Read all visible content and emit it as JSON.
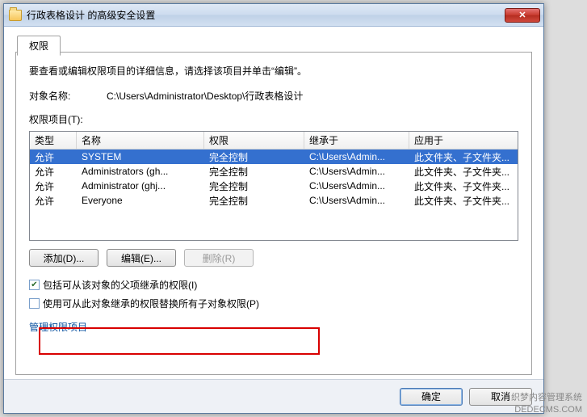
{
  "window": {
    "title": "行政表格设计 的高级安全设置",
    "close_symbol": "✕"
  },
  "tab": {
    "label": "权限"
  },
  "body": {
    "desc": "要查看或编辑权限项目的详细信息，请选择该项目并单击“编辑”。",
    "object_label": "对象名称:",
    "object_value": "C:\\Users\\Administrator\\Desktop\\行政表格设计",
    "perm_items_label": "权限项目(T):"
  },
  "columns": {
    "type": "类型",
    "name": "名称",
    "perm": "权限",
    "inherit": "继承于",
    "apply": "应用于"
  },
  "rows": [
    {
      "type": "允许",
      "name": "SYSTEM",
      "perm": "完全控制",
      "inherit": "C:\\Users\\Admin...",
      "apply": "此文件夹、子文件夹...",
      "selected": true
    },
    {
      "type": "允许",
      "name": "Administrators (gh...",
      "perm": "完全控制",
      "inherit": "C:\\Users\\Admin...",
      "apply": "此文件夹、子文件夹...",
      "selected": false
    },
    {
      "type": "允许",
      "name": "Administrator (ghj...",
      "perm": "完全控制",
      "inherit": "C:\\Users\\Admin...",
      "apply": "此文件夹、子文件夹...",
      "selected": false
    },
    {
      "type": "允许",
      "name": "Everyone",
      "perm": "完全控制",
      "inherit": "C:\\Users\\Admin...",
      "apply": "此文件夹、子文件夹...",
      "selected": false
    }
  ],
  "buttons": {
    "add": "添加(D)...",
    "edit": "编辑(E)...",
    "remove": "删除(R)"
  },
  "checks": {
    "include": "包括可从该对象的父项继承的权限(I)",
    "replace": "使用可从此对象继承的权限替换所有子对象权限(P)"
  },
  "link": "管理权限项目",
  "dialog_buttons": {
    "ok": "确定",
    "cancel": "取消"
  },
  "watermark": {
    "line1": "织梦内容管理系统",
    "line2": "DEDECMS.COM"
  }
}
